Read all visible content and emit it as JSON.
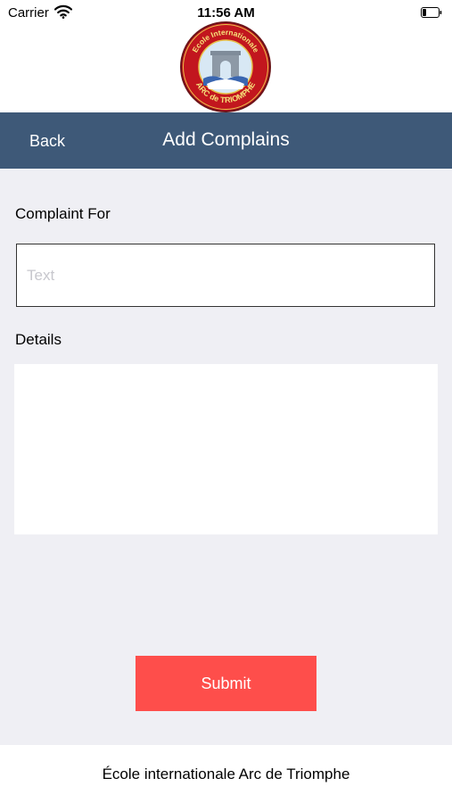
{
  "status_bar": {
    "carrier": "Carrier",
    "time": "11:56 AM",
    "wifi_icon": "wifi-icon",
    "battery_icon": "battery-icon"
  },
  "header": {
    "logo": {
      "top_text": "Ecole Internationale",
      "bottom_text": "ARC de TRIOMPHE"
    }
  },
  "navbar": {
    "back_label": "Back",
    "title": "Add Complains",
    "background_color": "#3e5978"
  },
  "form": {
    "complaint_for_label": "Complaint For",
    "complaint_for_value": "",
    "complaint_for_placeholder": "Text",
    "details_label": "Details",
    "details_value": "",
    "submit_label": "Submit",
    "submit_color": "#fe4e4b"
  },
  "footer": {
    "text": "École internationale Arc de Triomphe"
  }
}
